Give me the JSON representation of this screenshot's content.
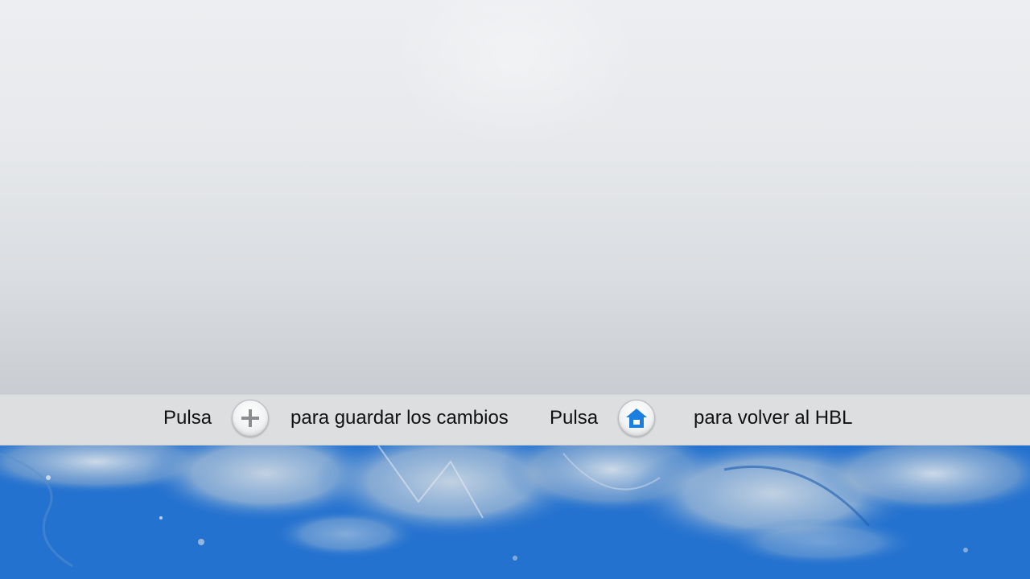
{
  "instructions": {
    "save": {
      "prefix": "Pulsa",
      "suffix": "para guardar los cambios",
      "icon": "plus-icon"
    },
    "home": {
      "prefix": "Pulsa",
      "suffix": "para volver al HBL",
      "icon": "home-icon"
    }
  },
  "colors": {
    "bar_background": "#dcdee0",
    "grunge_blue": "#2472cf",
    "home_icon_blue": "#1a7fe0",
    "plus_icon_gray": "#8a8c8f"
  }
}
